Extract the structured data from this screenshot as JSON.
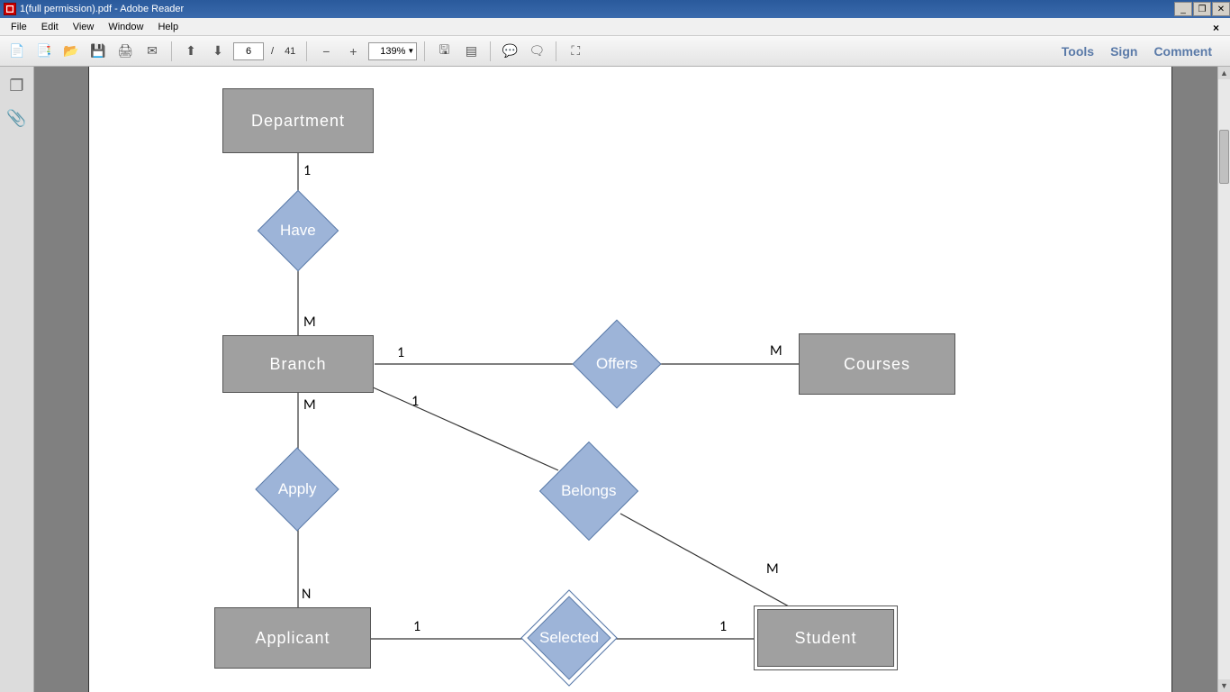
{
  "window": {
    "title": "1(full permission).pdf - Adobe Reader"
  },
  "menu": {
    "items": [
      "File",
      "Edit",
      "View",
      "Window",
      "Help"
    ]
  },
  "toolbar": {
    "page_current": "6",
    "page_sep": "/",
    "page_total": "41",
    "zoom": "139%"
  },
  "right_panel": {
    "tools": "Tools",
    "sign": "Sign",
    "comment": "Comment"
  },
  "er": {
    "entities": {
      "department": "Department",
      "branch": "Branch",
      "courses": "Courses",
      "applicant": "Applicant",
      "student": "Student"
    },
    "relationships": {
      "have": "Have",
      "offers": "Offers",
      "apply": "Apply",
      "belongs": "Belongs",
      "selected": "Selected"
    },
    "cardinality": {
      "dept_have": "1",
      "have_branch": "M",
      "branch_offers": "1",
      "offers_courses": "M",
      "branch_apply": "M",
      "apply_applicant": "N",
      "branch_belongs": "1",
      "belongs_student": "M",
      "applicant_selected": "1",
      "selected_student": "1"
    }
  }
}
